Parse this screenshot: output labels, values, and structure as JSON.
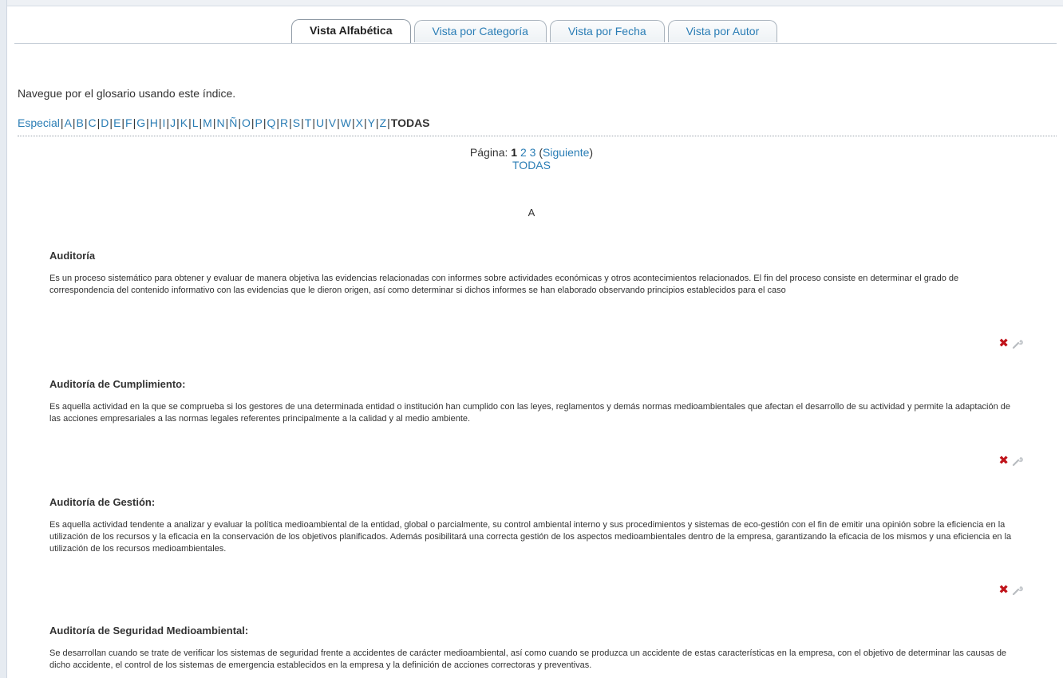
{
  "tabs": [
    {
      "label": "Vista Alfabética",
      "active": true
    },
    {
      "label": "Vista por Categoría",
      "active": false
    },
    {
      "label": "Vista por Fecha",
      "active": false
    },
    {
      "label": "Vista por Autor",
      "active": false
    }
  ],
  "intro": "Navegue por el glosario usando este índice.",
  "letters": [
    "Especial",
    "A",
    "B",
    "C",
    "D",
    "E",
    "F",
    "G",
    "H",
    "I",
    "J",
    "K",
    "L",
    "M",
    "N",
    "Ñ",
    "O",
    "P",
    "Q",
    "R",
    "S",
    "T",
    "U",
    "V",
    "W",
    "X",
    "Y",
    "Z"
  ],
  "letters_current": "TODAS",
  "paging": {
    "label": "Página:",
    "current": "1",
    "pages": [
      "2",
      "3"
    ],
    "next": "Siguiente",
    "all": "TODAS"
  },
  "section_letter": "A",
  "icons": {
    "delete": "delete-icon",
    "edit": "edit-wrench-icon"
  },
  "colors": {
    "link": "#2a7db5",
    "delete": "#c0141b"
  },
  "entries": [
    {
      "term": "Auditoría",
      "definition": "Es un proceso sistemático para obtener y evaluar de manera objetiva las evidencias relacionadas con informes sobre actividades económicas y otros acontecimientos relacionados. El fin del proceso consiste en determinar el grado de correspondencia del contenido informativo con las evidencias que le dieron origen, así como determinar si dichos informes se han elaborado observando principios establecidos para el caso"
    },
    {
      "term": "Auditoría de Cumplimiento:",
      "definition": "Es aquella actividad en la que se comprueba si los gestores de una determinada entidad o institución han cumplido con las leyes, reglamentos y demás normas medioambientales que afectan el desarrollo de su actividad y permite la adaptación de las acciones empresariales a las normas legales referentes principalmente a la calidad y al medio ambiente."
    },
    {
      "term": "Auditoría de Gestión:",
      "definition": "Es aquella actividad tendente a analizar y evaluar la política medioambiental de la entidad, global o parcialmente, su control ambiental interno y sus procedimientos y sistemas de eco-gestión con el fin de emitir una opinión sobre la eficiencia en la utilización de los recursos y la eficacia en la conservación de los objetivos planificados. Además posibilitará una correcta gestión de los aspectos medioambientales dentro de la empresa, garantizando la eficacia de los mismos y una eficiencia en la utilización de los recursos medioambientales."
    },
    {
      "term": "Auditoría de Seguridad Medioambiental:",
      "definition": "Se desarrollan cuando se trate de verificar los sistemas de seguridad frente a accidentes de carácter medioambiental, así como cuando se produzca un accidente de estas características en la empresa, con el objetivo de determinar las causas de dicho accidente, el control de los sistemas de emergencia establecidos en la empresa y la definición de acciones correctoras y preventivas."
    }
  ]
}
